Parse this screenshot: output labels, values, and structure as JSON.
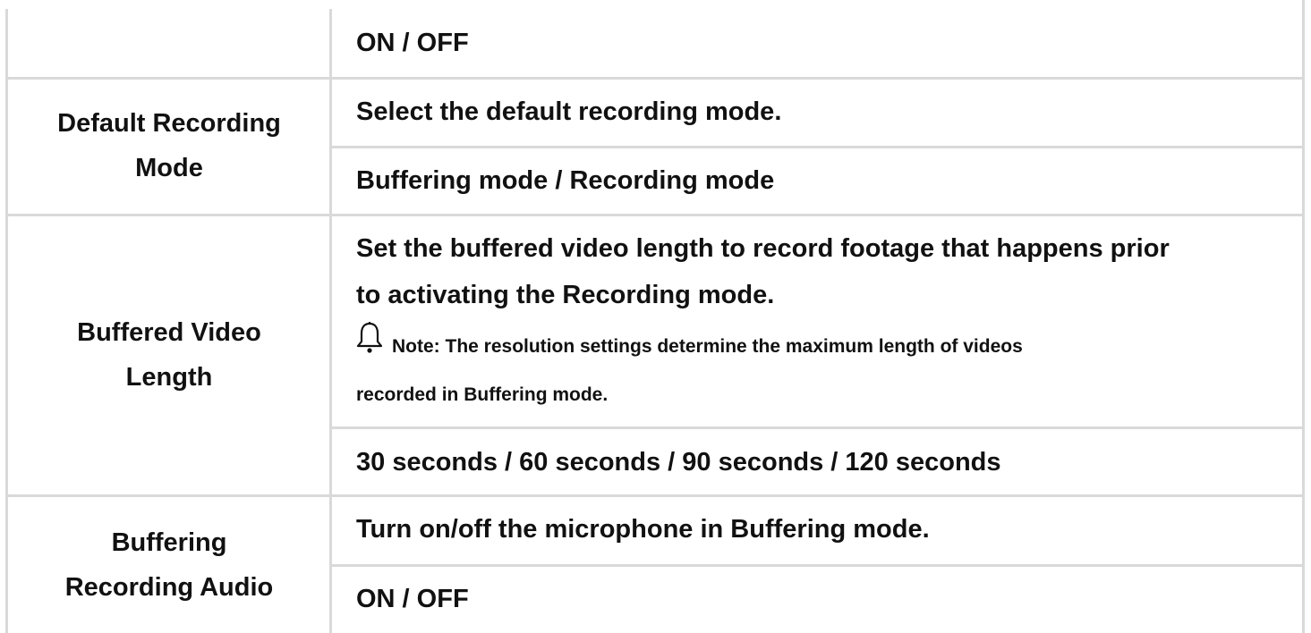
{
  "table": {
    "rows": [
      {
        "values": [
          "ON / OFF"
        ]
      },
      {
        "label_line1": "Default Recording",
        "label_line2": "Mode",
        "description": "Select the default recording mode.",
        "options": "Buffering mode / Recording mode"
      },
      {
        "label_line1": "Buffered Video",
        "label_line2": "Length",
        "description_line1": "Set the buffered video length to record footage that happens prior",
        "description_line2": "to activating the Recording mode.",
        "note_icon": "bell-icon",
        "note_line1": "Note: The resolution settings determine the maximum length of videos",
        "note_line2": "recorded in Buffering mode.",
        "options": "30 seconds / 60 seconds / 90 seconds / 120 seconds"
      },
      {
        "label_line1": "Buffering",
        "label_line2": "Recording Audio",
        "description": "Turn on/off the microphone in Buffering mode.",
        "options": "ON / OFF"
      }
    ]
  },
  "colors": {
    "border": "#d9d9d9",
    "text": "#111111"
  }
}
